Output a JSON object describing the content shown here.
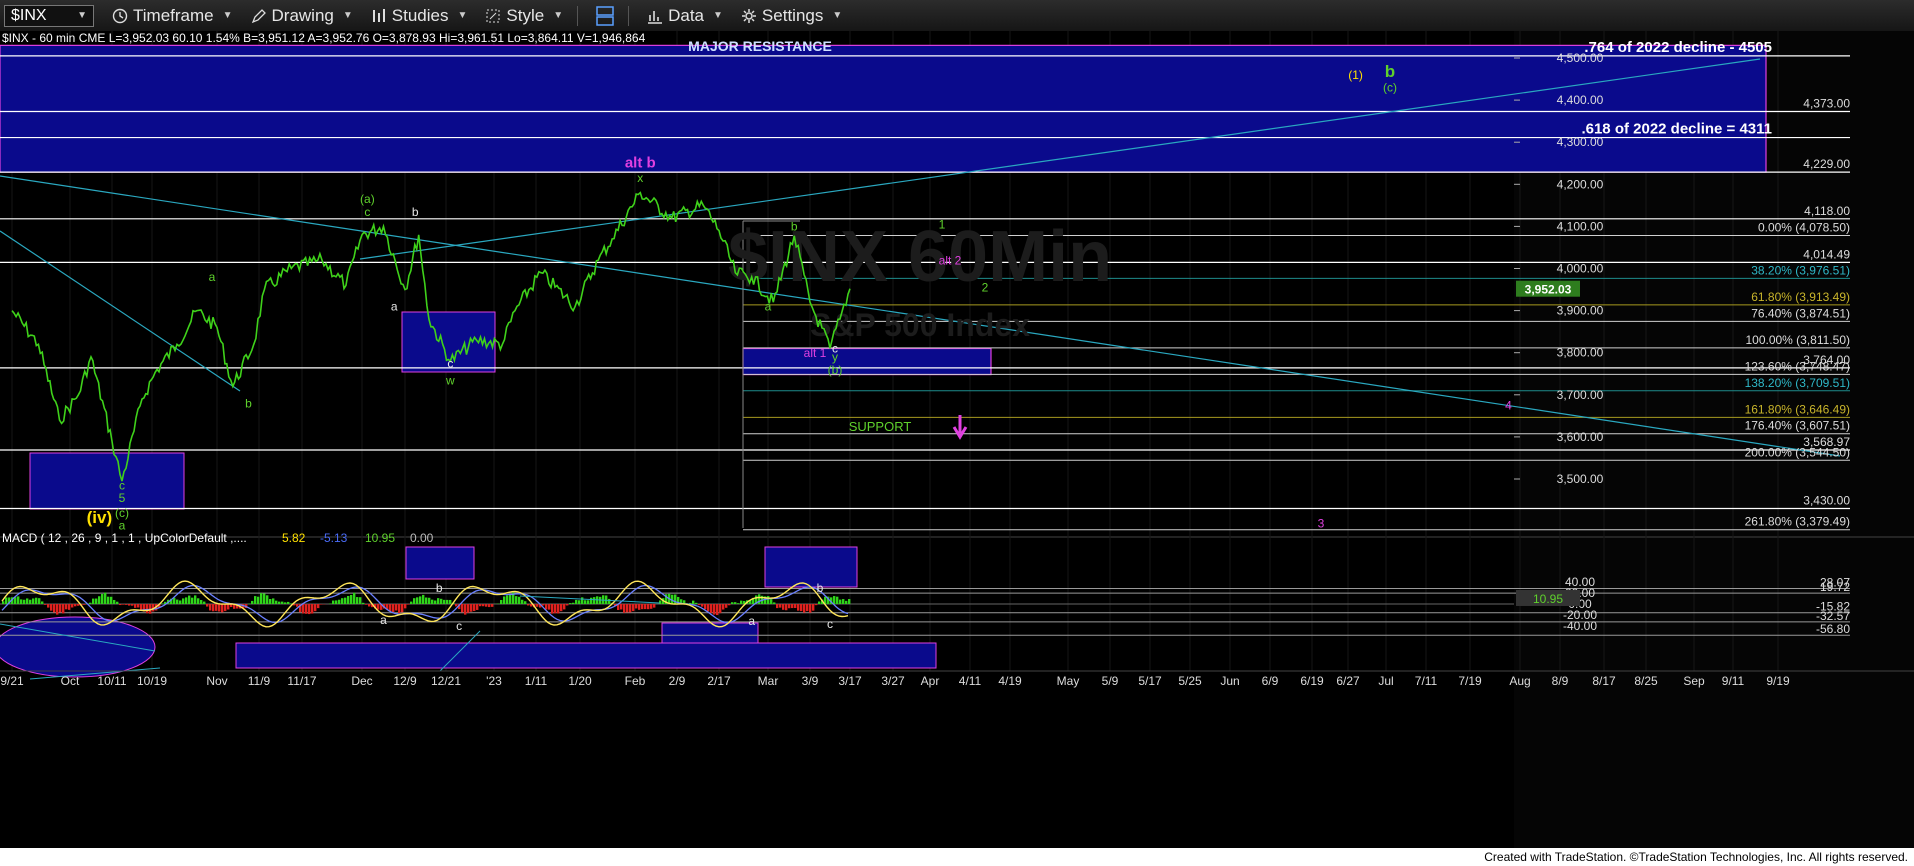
{
  "toolbar": {
    "symbol": "$INX",
    "items": [
      {
        "id": "timeframe",
        "label": "Timeframe",
        "icon": "clock-icon"
      },
      {
        "id": "drawing",
        "label": "Drawing",
        "icon": "pencil-icon"
      },
      {
        "id": "studies",
        "label": "Studies",
        "icon": "studies-icon"
      },
      {
        "id": "style",
        "label": "Style",
        "icon": "style-icon"
      },
      {
        "id": "layout",
        "label": "",
        "icon": "layout-icon"
      },
      {
        "id": "data",
        "label": "Data",
        "icon": "bar-chart-icon"
      },
      {
        "id": "settings",
        "label": "Settings",
        "icon": "gear-icon"
      }
    ]
  },
  "quote": {
    "header": "$INX - 60 min  CME  L=3,952.03  60.10  1.54%  B=3,951.12  A=3,952.76  O=3,878.93  Hi=3,961.51  Lo=3,864.11  V=1,946,864"
  },
  "chart_data": {
    "type": "line",
    "symbol": "$INX",
    "timeframe": "60 min",
    "ylim": [
      3370,
      4560
    ],
    "price_ticks": [
      3500,
      3600,
      3700,
      3800,
      3900,
      4000,
      4100,
      4200,
      4300,
      4400,
      4500
    ],
    "last_price": "3,952.03",
    "date_labels": [
      "9/21",
      "Oct",
      "10/11",
      "10/19",
      "Nov",
      "11/9",
      "11/17",
      "Dec",
      "12/9",
      "12/21",
      "'23",
      "1/11",
      "1/20",
      "Feb",
      "2/9",
      "2/17",
      "Mar",
      "3/9",
      "3/17",
      "3/27",
      "Apr",
      "4/11",
      "4/19",
      "May",
      "5/9",
      "5/17",
      "5/25",
      "Jun",
      "6/9",
      "6/19",
      "6/27",
      "Jul",
      "7/11",
      "7/19",
      "Aug",
      "8/9",
      "8/17",
      "8/25",
      "Sep",
      "9/11",
      "9/19"
    ],
    "price_series": {
      "name": "",
      "points": [
        {
          "x": "9/21",
          "y": 3900
        },
        {
          "x": "9/26",
          "y": 3820
        },
        {
          "x": "9/30",
          "y": 3640
        },
        {
          "x": "10/3",
          "y": 3700
        },
        {
          "x": "10/6",
          "y": 3790
        },
        {
          "x": "10/11",
          "y": 3590
        },
        {
          "x": "10/13",
          "y": 3495
        },
        {
          "x": "10/17",
          "y": 3690
        },
        {
          "x": "10/20",
          "y": 3760
        },
        {
          "x": "10/24",
          "y": 3820
        },
        {
          "x": "10/28",
          "y": 3900
        },
        {
          "x": "11/1",
          "y": 3860
        },
        {
          "x": "11/4",
          "y": 3720
        },
        {
          "x": "11/8",
          "y": 3820
        },
        {
          "x": "11/10",
          "y": 3950
        },
        {
          "x": "11/15",
          "y": 4000
        },
        {
          "x": "11/22",
          "y": 4020
        },
        {
          "x": "11/28",
          "y": 3960
        },
        {
          "x": "12/1",
          "y": 4080
        },
        {
          "x": "12/5",
          "y": 4100
        },
        {
          "x": "12/9",
          "y": 3950
        },
        {
          "x": "12/13",
          "y": 4080
        },
        {
          "x": "12/16",
          "y": 3880
        },
        {
          "x": "12/22",
          "y": 3780
        },
        {
          "x": "12/28",
          "y": 3830
        },
        {
          "x": "1/3",
          "y": 3820
        },
        {
          "x": "1/6",
          "y": 3900
        },
        {
          "x": "1/12",
          "y": 3990
        },
        {
          "x": "1/19",
          "y": 3910
        },
        {
          "x": "1/24",
          "y": 4020
        },
        {
          "x": "1/27",
          "y": 4070
        },
        {
          "x": "2/2",
          "y": 4180
        },
        {
          "x": "2/8",
          "y": 4120
        },
        {
          "x": "2/14",
          "y": 4150
        },
        {
          "x": "2/17",
          "y": 4090
        },
        {
          "x": "2/22",
          "y": 3990
        },
        {
          "x": "2/27",
          "y": 3980
        },
        {
          "x": "3/2",
          "y": 3920
        },
        {
          "x": "3/6",
          "y": 4078
        },
        {
          "x": "3/9",
          "y": 3920
        },
        {
          "x": "3/13",
          "y": 3810
        },
        {
          "x": "3/15",
          "y": 3880
        },
        {
          "x": "3/17",
          "y": 3952
        }
      ]
    },
    "zones": [
      {
        "label": "MAJOR RESISTANCE",
        "y_top": 4530,
        "y_bottom": 4229
      },
      {
        "label": "SUPPORT",
        "y_top": 3810,
        "y_bottom": 3748
      }
    ],
    "levels": [
      {
        "label": ".764 of 2022 decline - 4505",
        "value": 4505
      },
      {
        "label": "4,373.00",
        "value": 4373
      },
      {
        "label": ".618 of 2022 decline = 4311",
        "value": 4311
      },
      {
        "label": "4,229.00",
        "value": 4229
      },
      {
        "label": "4,118.00",
        "value": 4118
      },
      {
        "label": "0.00% (4,078.50)",
        "value": 4078.5
      },
      {
        "label": "4,014.49",
        "value": 4014.49
      },
      {
        "label": "38.20% (3,976.51)",
        "value": 3976.51
      },
      {
        "label": "61.80% (3,913.49)",
        "value": 3913.49
      },
      {
        "label": "76.40% (3,874.51)",
        "value": 3874.51
      },
      {
        "label": "100.00% (3,811.50)",
        "value": 3811.5
      },
      {
        "label": "3,764.00",
        "value": 3764
      },
      {
        "label": "123.60% (3,748.47)",
        "value": 3748.47
      },
      {
        "label": "138.20% (3,709.51)",
        "value": 3709.51
      },
      {
        "label": "161.80% (3,646.49)",
        "value": 3646.49
      },
      {
        "label": "176.40% (3,607.51)",
        "value": 3607.51
      },
      {
        "label": "3,568.97",
        "value": 3568.97
      },
      {
        "label": "200.00% (3,544.50)",
        "value": 3544.5
      },
      {
        "label": "3,430.00",
        "value": 3430
      },
      {
        "label": "261.80% (3,379.49)",
        "value": 3379.49
      }
    ],
    "wave_labels": [
      {
        "text": "alt b",
        "color": "#e040e0",
        "x": "2/2",
        "y": 4240
      },
      {
        "text": "x",
        "color": "#5fd12c",
        "x": "2/2",
        "y": 4205
      },
      {
        "text": "(a)",
        "color": "#5fd12c",
        "x": "12/2",
        "y": 4155
      },
      {
        "text": "c",
        "color": "#5fd12c",
        "x": "12/2",
        "y": 4125
      },
      {
        "text": "b",
        "color": "#e6e6e6",
        "x": "12/12",
        "y": 4125
      },
      {
        "text": "a",
        "color": "#e6e6e6",
        "x": "12/7",
        "y": 3900
      },
      {
        "text": "c",
        "color": "#e6e6e6",
        "x": "12/22",
        "y": 3765
      },
      {
        "text": "w",
        "color": "#5fd12c",
        "x": "12/22",
        "y": 3725
      },
      {
        "text": "a",
        "color": "#5fd12c",
        "x": "10/31",
        "y": 3970
      },
      {
        "text": "b",
        "color": "#5fd12c",
        "x": "11/7",
        "y": 3670
      },
      {
        "text": "c",
        "color": "#5fd12c",
        "x": "10/13",
        "y": 3475
      },
      {
        "text": "5",
        "color": "#5fd12c",
        "x": "10/13",
        "y": 3445
      },
      {
        "text": "(c)",
        "color": "#5fd12c",
        "x": "10/13",
        "y": 3410
      },
      {
        "text": "(iv)",
        "color": "#ffe100",
        "x": "10/8",
        "y": 3395
      },
      {
        "text": "a",
        "color": "#5fd12c",
        "x": "10/13",
        "y": 3380
      },
      {
        "text": "b",
        "color": "#5fd12c",
        "x": "3/6",
        "y": 4090
      },
      {
        "text": "a",
        "color": "#5fd12c",
        "x": "3/1",
        "y": 3900
      },
      {
        "text": "c",
        "color": "#e6e6e6",
        "x": "3/14",
        "y": 3800
      },
      {
        "text": "y",
        "color": "#5fd12c",
        "x": "3/14",
        "y": 3780
      },
      {
        "text": "(b)",
        "color": "#5fd12c",
        "x": "3/14",
        "y": 3750
      },
      {
        "text": "alt 1",
        "color": "#e040e0",
        "x": "3/10",
        "y": 3790
      },
      {
        "text": "1",
        "color": "#5fd12c",
        "x": "4/4",
        "y": 4095
      },
      {
        "text": "alt 2",
        "color": "#e040e0",
        "x": "4/6",
        "y": 4010
      },
      {
        "text": "2",
        "color": "#5fd12c",
        "x": "4/14",
        "y": 3945
      },
      {
        "text": "4",
        "color": "#e040e0",
        "x": "7/29",
        "y": 3665
      },
      {
        "text": "3",
        "color": "#e040e0",
        "x": "6/21",
        "y": 3385
      },
      {
        "text": "(1)",
        "color": "#ffe100",
        "x": "6/28",
        "y": 4450
      },
      {
        "text": "b",
        "color": "#5fd12c",
        "x": "7/2",
        "y": 4455
      },
      {
        "text": "(c)",
        "color": "#5fd12c",
        "x": "7/2",
        "y": 4420
      }
    ],
    "watermark": [
      "$INX 60Min",
      "S&P 500 Index"
    ]
  },
  "macd": {
    "header": "MACD ( 12 , 26 , 9 , 1 , 1 , UpColorDefault ,....",
    "values": [
      {
        "text": "5.82",
        "color": "#ffe100"
      },
      {
        "text": "-5.13",
        "color": "#4a6cf7"
      },
      {
        "text": "10.95",
        "color": "#5fd12c"
      },
      {
        "text": "0.00",
        "color": "#bbbbbb"
      }
    ],
    "ylim": [
      -60,
      52
    ],
    "axis_ticks": [
      "40.00",
      "20.00",
      "0.00",
      "-20.00",
      "-40.00"
    ],
    "levels": [
      "28.07",
      "19.72",
      "-15.82",
      "-32.57",
      "-56.80"
    ],
    "current": "10.95",
    "labels": [
      {
        "text": "b",
        "x": "12/19",
        "y": 22
      },
      {
        "text": "b",
        "x": "3/11",
        "y": 22
      },
      {
        "text": "a",
        "x": "12/5",
        "y": -36
      },
      {
        "text": "c",
        "x": "12/24",
        "y": -47
      },
      {
        "text": "a",
        "x": "2/27",
        "y": -38
      },
      {
        "text": "c",
        "x": "3/13",
        "y": -44
      }
    ]
  },
  "footer": {
    "text": "Created with TradeStation. ©TradeStation Technologies, Inc. All rights reserved."
  }
}
